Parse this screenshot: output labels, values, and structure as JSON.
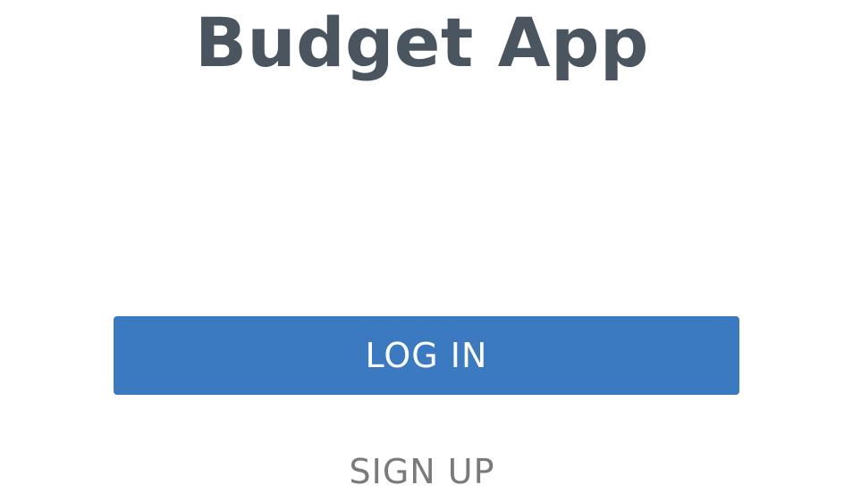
{
  "app": {
    "title": "Budget App"
  },
  "auth": {
    "login_label": "LOG IN",
    "signup_label": "SIGN UP"
  },
  "colors": {
    "title": "#4a5560",
    "primary": "#3b7ac0",
    "primary_text": "#ffffff",
    "secondary_text": "#7a7a7a",
    "background": "#ffffff"
  }
}
